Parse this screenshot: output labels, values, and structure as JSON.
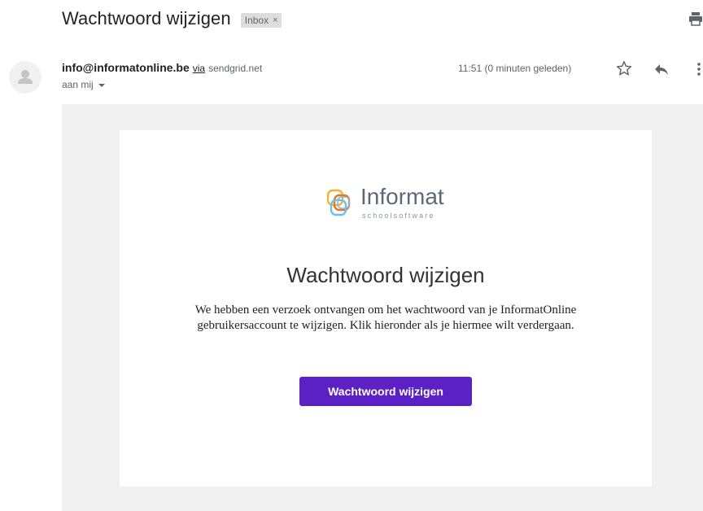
{
  "header": {
    "subject": "Wachtwoord wijzigen",
    "label_badge": "Inbox",
    "label_remove": "×",
    "print_icon": "printer-icon"
  },
  "message": {
    "sender_email": "info@informatonline.be",
    "via_label": "via",
    "via_domain": "sendgrid.net",
    "recipient": "aan mij",
    "time": "11:51 (0 minuten geleden)",
    "icons": [
      "avatar-icon",
      "star-icon",
      "reply-icon",
      "more-vert-icon",
      "chevron-down-icon"
    ]
  },
  "email_content": {
    "logo_text": "Informat",
    "logo_sub": "schoolsoftware",
    "title": "Wachtwoord wijzigen",
    "body_text": "We hebben een verzoek ontvangen om het wachtwoord van je InformatOnline gebruikersaccount te wijzigen. Klik hieronder als je hiermee wilt verdergaan.",
    "button_label": "Wachtwoord wijzigen",
    "button_color": "#5b21c4"
  }
}
